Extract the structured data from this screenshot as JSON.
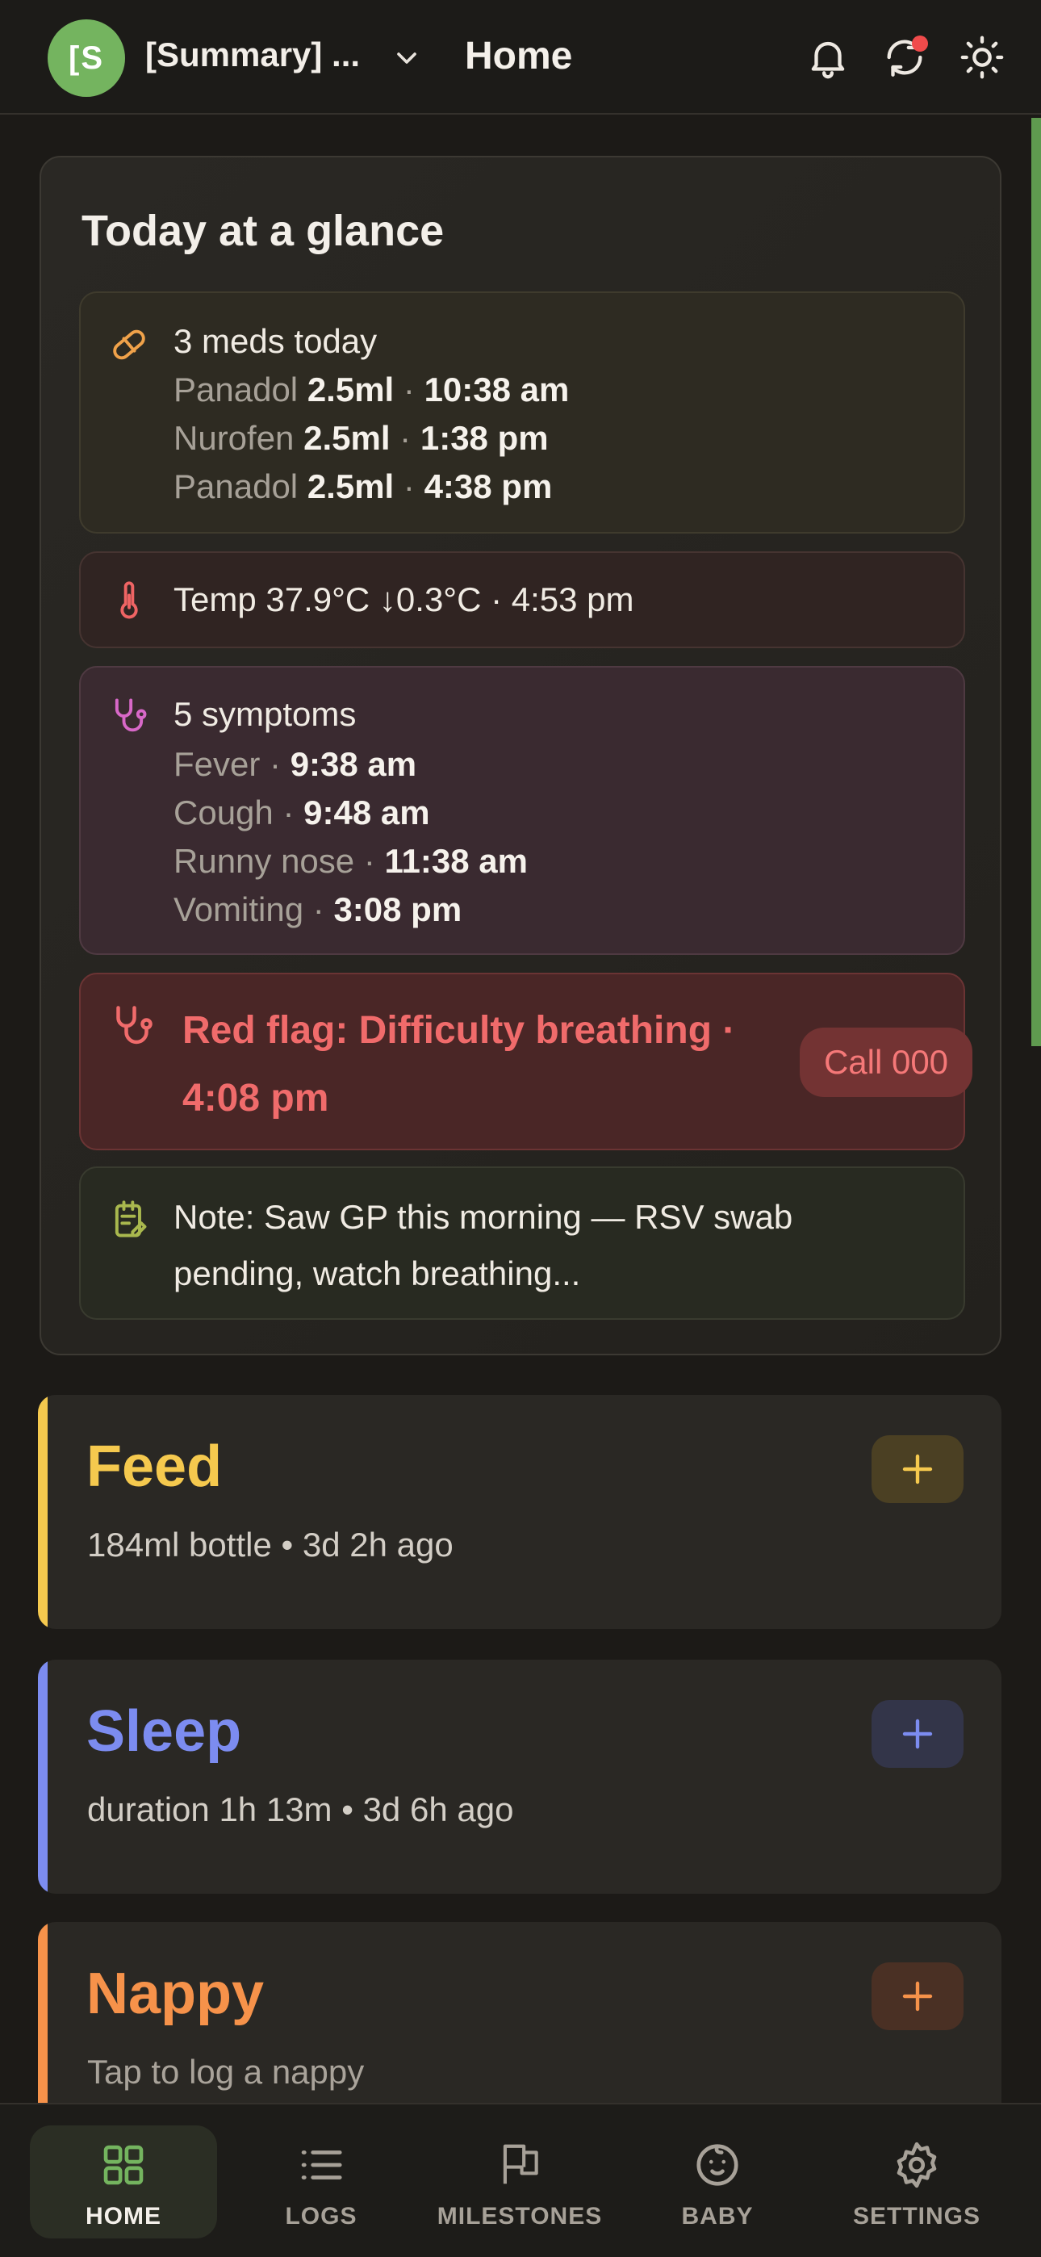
{
  "header": {
    "avatar_text": "[S",
    "profile_name": "[Summary] ...",
    "title": "Home"
  },
  "glance": {
    "title": "Today at a glance",
    "meds": {
      "summary": "3 meds today",
      "items": [
        {
          "name": "Panadol",
          "dose": "2.5ml",
          "time": "10:38 am"
        },
        {
          "name": "Nurofen",
          "dose": "2.5ml",
          "time": "1:38 pm"
        },
        {
          "name": "Panadol",
          "dose": "2.5ml",
          "time": "4:38 pm"
        }
      ]
    },
    "temp": "Temp 37.9°C ↓0.3°C · 4:53 pm",
    "symptoms": {
      "summary": "5 symptoms",
      "items": [
        {
          "name": "Fever",
          "time": "9:38 am"
        },
        {
          "name": "Cough",
          "time": "9:48 am"
        },
        {
          "name": "Runny nose",
          "time": "11:38 am"
        },
        {
          "name": "Vomiting",
          "time": "3:08 pm"
        }
      ]
    },
    "red_flag": {
      "text": "Red flag: Difficulty breathing · 4:08 pm",
      "call_label": "Call 000"
    },
    "note": "Note: Saw GP this morning — RSV swab pending, watch breathing..."
  },
  "activities": {
    "feed": {
      "title": "Feed",
      "subtitle": "184ml bottle • 3d 2h ago",
      "color": "#f5c94e"
    },
    "sleep": {
      "title": "Sleep",
      "subtitle": "duration 1h 13m • 3d 6h ago",
      "color": "#7c8cf0"
    },
    "nappy": {
      "title": "Nappy",
      "subtitle": "Tap to log a nappy",
      "color": "#f6924a"
    }
  },
  "nav": {
    "home": "HOME",
    "logs": "LOGS",
    "milestones": "MILESTONES",
    "baby": "BABY",
    "settings": "SETTINGS",
    "active": "home"
  },
  "colors": {
    "background": "#1c1a17",
    "accent_green": "#74b45f",
    "alert_red": "#f06b6b"
  }
}
